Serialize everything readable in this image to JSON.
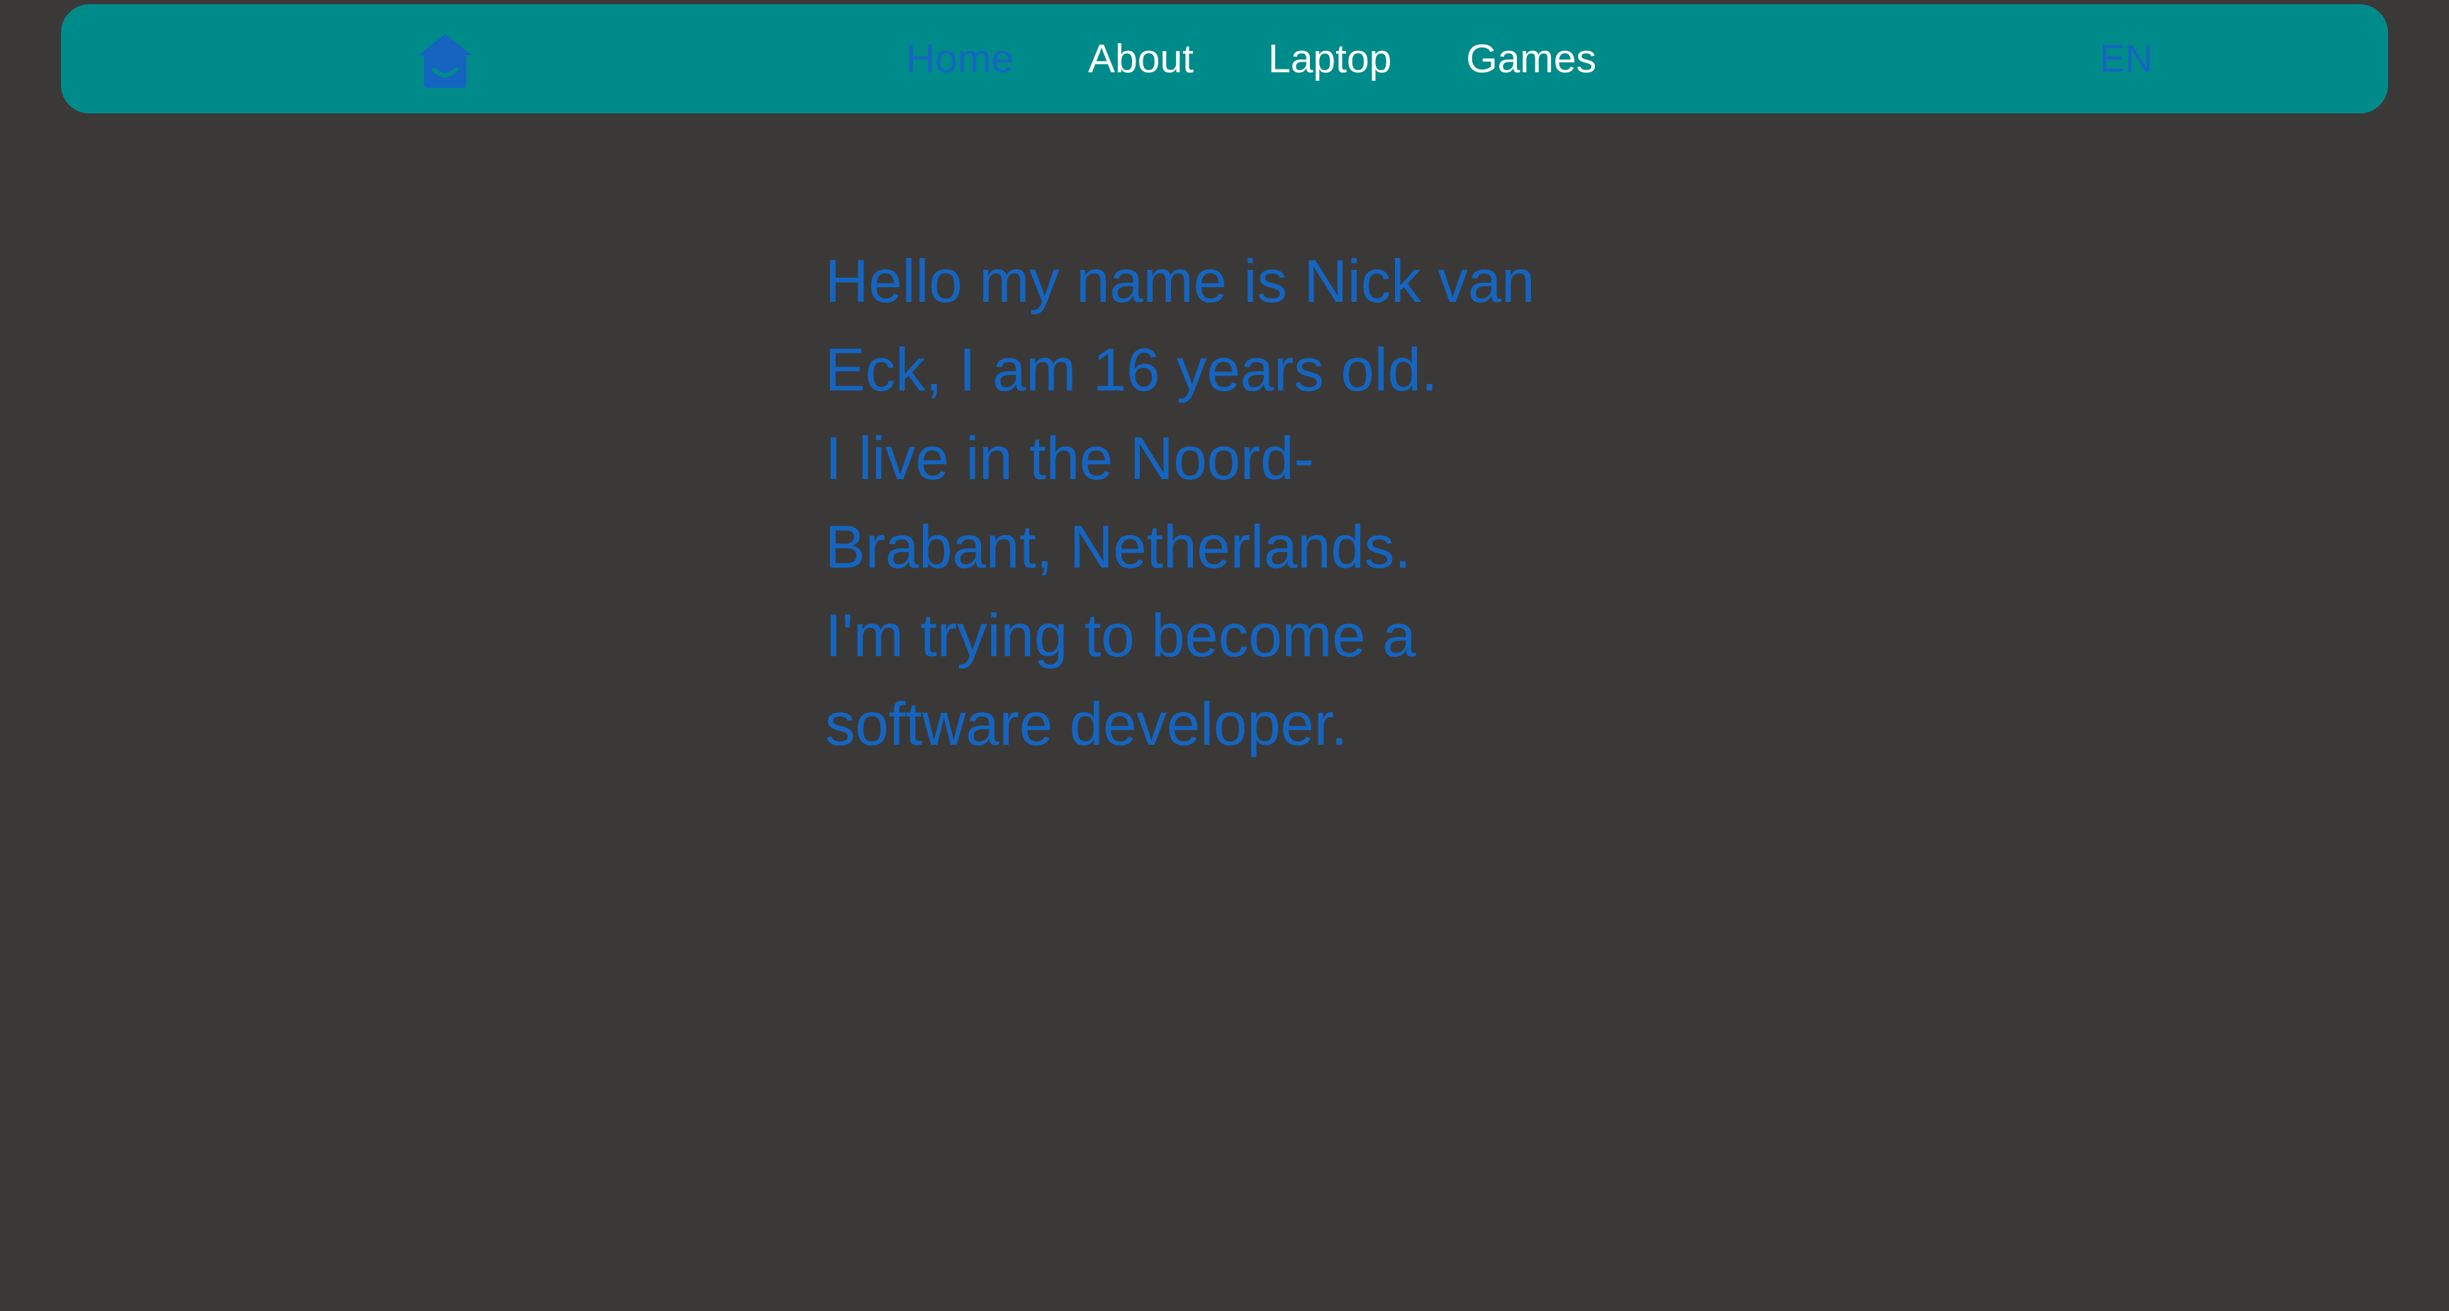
{
  "colors": {
    "page_background": "#3a3938",
    "navbar_background": "#008b8b",
    "accent_blue": "#1565c0",
    "nav_text": "#ffffff"
  },
  "navbar": {
    "logo_icon": "home-smile-icon",
    "links": [
      {
        "label": "Home",
        "active": true
      },
      {
        "label": "About",
        "active": false
      },
      {
        "label": "Laptop",
        "active": false
      },
      {
        "label": "Games",
        "active": false
      }
    ],
    "language": "EN"
  },
  "intro": {
    "lines": [
      "Hello my name is Nick van",
      "Eck, I am 16 years old.",
      "I live in the Noord-",
      "Brabant, Netherlands.",
      "I'm trying to become a",
      "software developer."
    ]
  }
}
